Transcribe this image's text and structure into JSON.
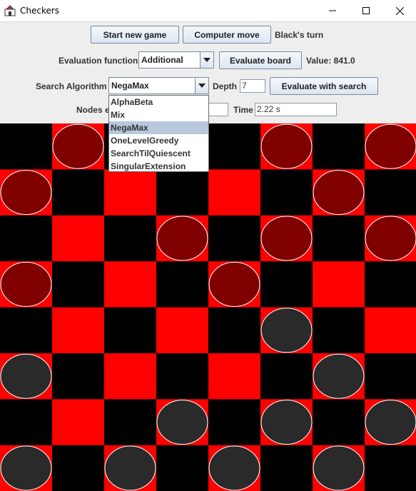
{
  "window": {
    "title": "Checkers"
  },
  "controls": {
    "new_game": "Start new game",
    "computer_move": "Computer move",
    "turn_status": "Black's turn",
    "eval_label": "Evaluation function",
    "eval_selected": "Additional",
    "evaluate_board": "Evaluate board",
    "value_text": "Value: 841.0",
    "search_label": "Search Algorithm",
    "search_selected": "NegaMax",
    "depth_label": "Depth",
    "depth_value": "7",
    "evaluate_search": "Evaluate with search",
    "nodes_label": "Nodes e",
    "nodes_value": "",
    "time_label": "Time",
    "time_value": "2.22 s"
  },
  "dropdown": {
    "options": [
      "AlphaBeta",
      "Mix",
      "NegaMax",
      "OneLevelGreedy",
      "SearchTilQuiescent",
      "SingularExtension"
    ],
    "selected_index": 2
  },
  "board": {
    "colors": {
      "dark_square": "#000000",
      "light_square": "#ff0000",
      "red_piece": "#800000",
      "black_piece": "#2a2a2a",
      "piece_outline": "#ffffff"
    },
    "pieces": [
      {
        "row": 0,
        "col": 1,
        "color": "red"
      },
      {
        "row": 0,
        "col": 5,
        "color": "red"
      },
      {
        "row": 0,
        "col": 7,
        "color": "red"
      },
      {
        "row": 1,
        "col": 0,
        "color": "red"
      },
      {
        "row": 1,
        "col": 6,
        "color": "red"
      },
      {
        "row": 2,
        "col": 3,
        "color": "red"
      },
      {
        "row": 2,
        "col": 5,
        "color": "red"
      },
      {
        "row": 2,
        "col": 7,
        "color": "red"
      },
      {
        "row": 3,
        "col": 0,
        "color": "red"
      },
      {
        "row": 3,
        "col": 4,
        "color": "red"
      },
      {
        "row": 4,
        "col": 5,
        "color": "black"
      },
      {
        "row": 5,
        "col": 0,
        "color": "black"
      },
      {
        "row": 5,
        "col": 6,
        "color": "black"
      },
      {
        "row": 6,
        "col": 3,
        "color": "black"
      },
      {
        "row": 6,
        "col": 5,
        "color": "black"
      },
      {
        "row": 6,
        "col": 7,
        "color": "black"
      },
      {
        "row": 7,
        "col": 0,
        "color": "black"
      },
      {
        "row": 7,
        "col": 2,
        "color": "black"
      },
      {
        "row": 7,
        "col": 4,
        "color": "black"
      },
      {
        "row": 7,
        "col": 6,
        "color": "black"
      }
    ]
  }
}
